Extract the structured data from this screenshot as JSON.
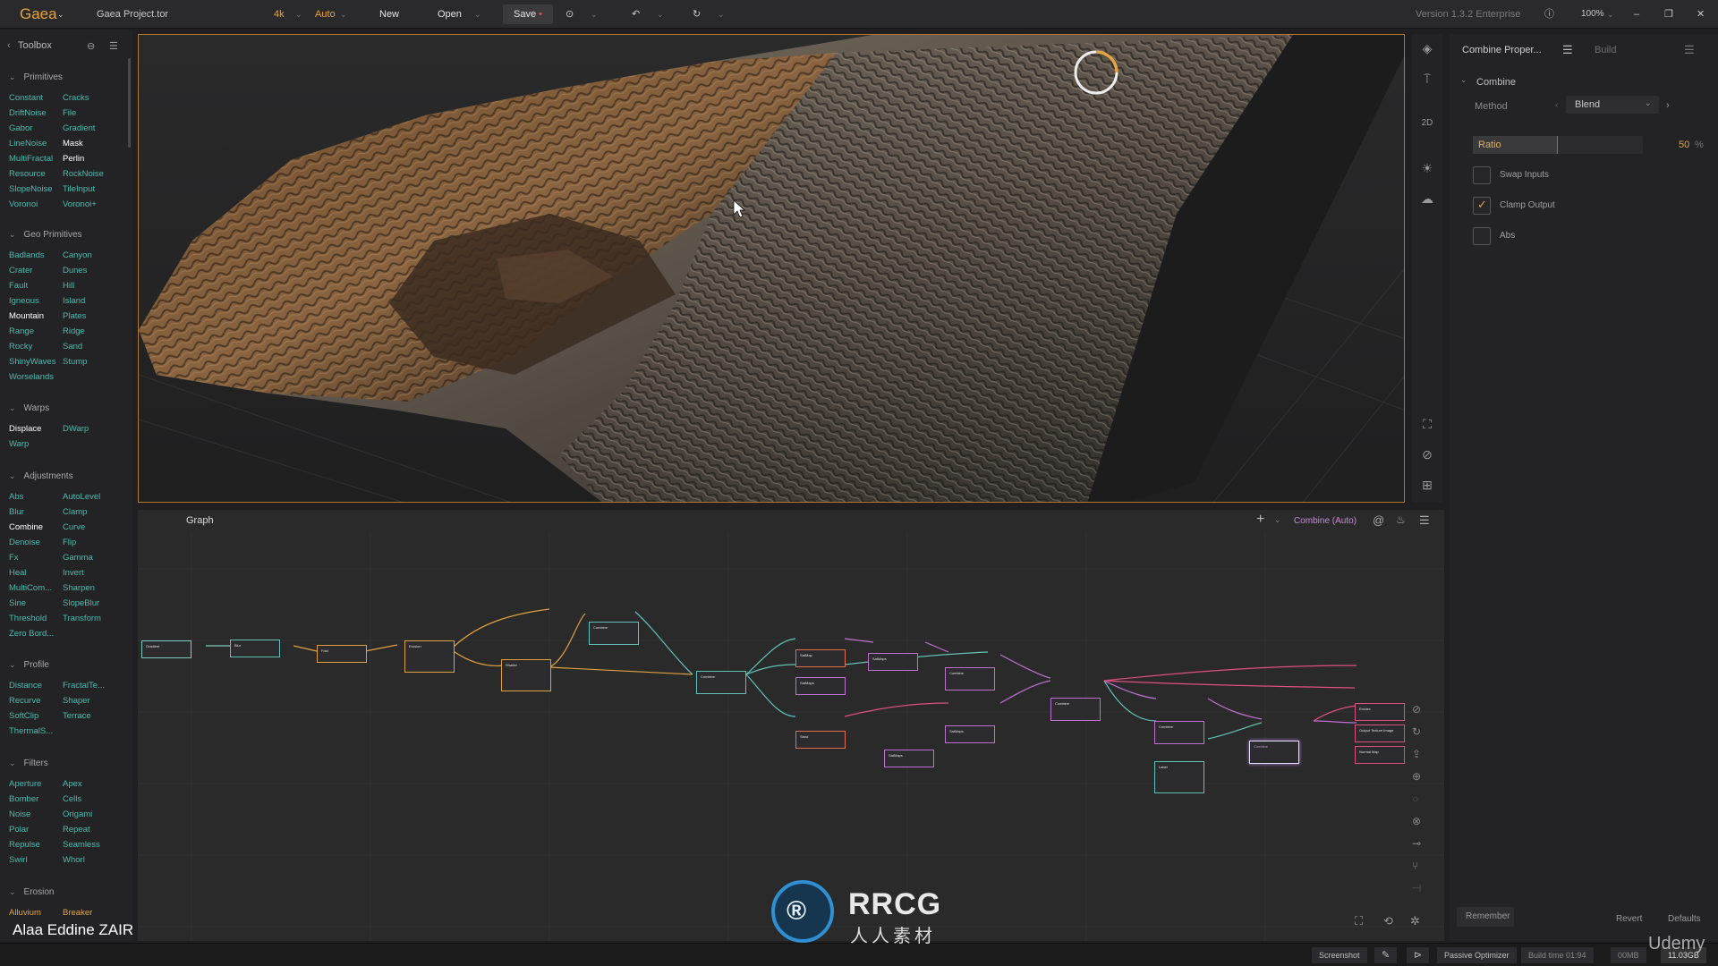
{
  "topbar": {
    "app_name": "Gaea",
    "project_name": "Gaea Project.tor",
    "resolution": "4k",
    "mode": "Auto",
    "new_label": "New",
    "open_label": "Open",
    "save_label": "Save",
    "version": "Version 1.3.2 Enterprise",
    "zoom": "100%"
  },
  "toolbox": {
    "title": "Toolbox",
    "categories": [
      {
        "name": "Primitives",
        "items": [
          "Constant",
          "Cracks",
          "DriftNoise",
          "File",
          "Gabor",
          "Gradient",
          "LineNoise",
          "Mask",
          "MultiFractal",
          "Perlin",
          "Resource",
          "RockNoise",
          "SlopeNoise",
          "TileInput",
          "Voronoi",
          "Voronoi+"
        ]
      },
      {
        "name": "Geo Primitives",
        "items": [
          "Badlands",
          "Canyon",
          "Crater",
          "Dunes",
          "Fault",
          "Hill",
          "Igneous",
          "Island",
          "Mountain",
          "Plates",
          "Range",
          "Ridge",
          "Rocky",
          "Sand",
          "ShinyWaves",
          "Stump",
          "Worselands"
        ]
      },
      {
        "name": "Warps",
        "items": [
          "Displace",
          "DWarp",
          "Warp"
        ]
      },
      {
        "name": "Adjustments",
        "items": [
          "Abs",
          "AutoLevel",
          "Blur",
          "Clamp",
          "Combine",
          "Curve",
          "Denoise",
          "Flip",
          "Fx",
          "Gamma",
          "Heal",
          "Invert",
          "MultiCom...",
          "Sharpen",
          "Sine",
          "SlopeBlur",
          "Threshold",
          "Transform",
          "Zero Bord..."
        ]
      },
      {
        "name": "Profile",
        "items": [
          "Distance",
          "FractalTe...",
          "Recurve",
          "Shaper",
          "SoftClip",
          "Terrace",
          "ThermalS..."
        ]
      },
      {
        "name": "Filters",
        "items": [
          "Aperture",
          "Apex",
          "Bomber",
          "Cells",
          "Noise",
          "Origami",
          "Polar",
          "Repeat",
          "Repulse",
          "Seamless",
          "Swirl",
          "Whorl"
        ]
      },
      {
        "name": "Erosion",
        "items": [
          "Alluvium",
          "Breaker"
        ]
      }
    ]
  },
  "graph": {
    "title": "Graph",
    "active_node": "Combine (Auto)",
    "nodes": [
      "Gradient",
      "Blur",
      "Fold",
      "Erosion",
      "Shader",
      "Combine",
      "Combine",
      "SatMap",
      "SatMaps",
      "SatMaps",
      "Combine",
      "Combine",
      "Sand",
      "SatMaps",
      "SatMaps",
      "Combine",
      "Label",
      "Combine",
      "Erodex",
      "Output Texture Image",
      "Normal Map"
    ]
  },
  "props": {
    "tab_properties": "Combine Proper...",
    "tab_build": "Build",
    "section": "Combine",
    "method_label": "Method",
    "method_value": "Blend",
    "ratio_label": "Ratio",
    "ratio_value": "50",
    "ratio_unit": "%",
    "ratio_fraction": 0.5,
    "swap_inputs_label": "Swap Inputs",
    "swap_inputs": false,
    "clamp_output_label": "Clamp Output",
    "clamp_output": true,
    "abs_label": "Abs",
    "abs": false,
    "remember_label": "Remember",
    "revert_label": "Revert",
    "defaults_label": "Defaults"
  },
  "status": {
    "screenshot_label": "Screenshot",
    "optimizer_label": "Passive Optimizer",
    "build_time": "Build time 01:94",
    "memory": "00MB",
    "time_right": "11.03GB"
  },
  "overlays": {
    "author": "Alaa Eddine ZAIR",
    "watermark_brand": "RRCG",
    "watermark_sub": "人人素材",
    "udemy": "Udemy"
  },
  "colors": {
    "accent": "#e8a43a",
    "node_text": "#4bbcb1",
    "background": "#1f1f21"
  }
}
